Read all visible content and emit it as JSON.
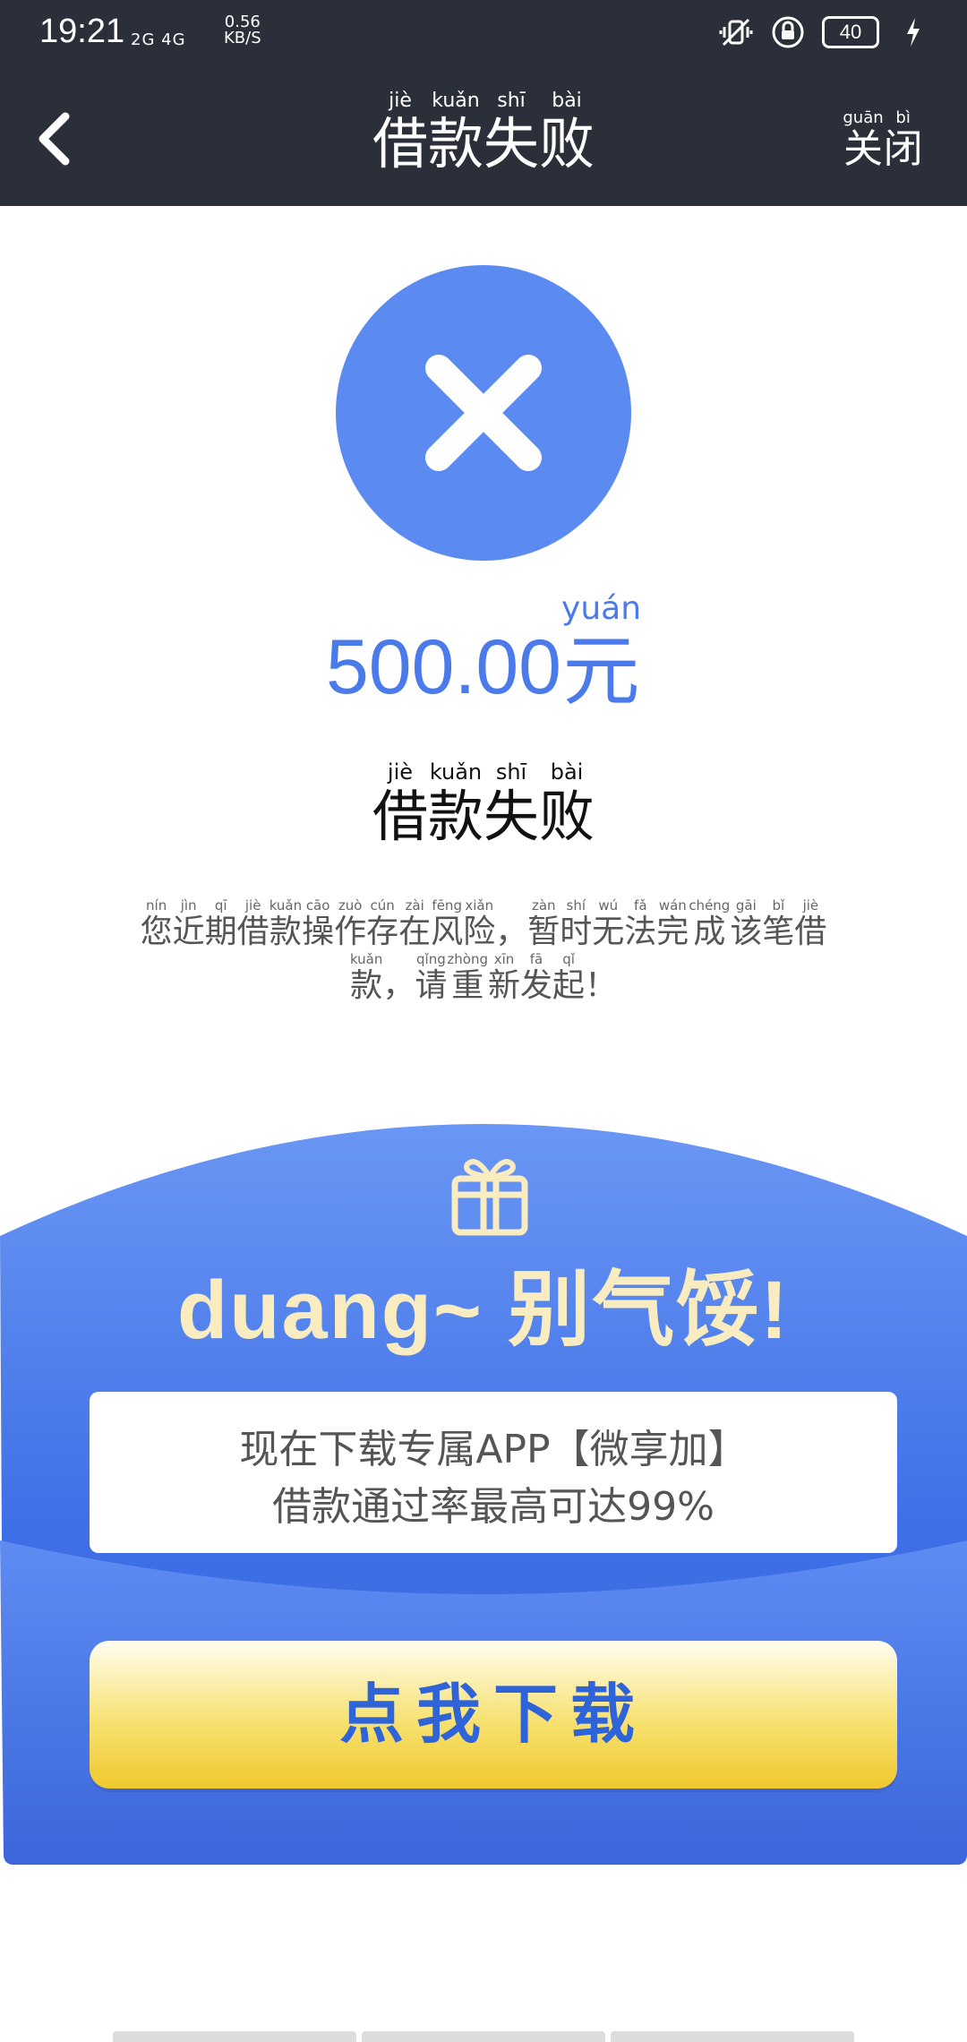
{
  "status_bar": {
    "time": "19:21",
    "network": "2G 4G",
    "speed": "0.56",
    "speed_unit": "KB/S",
    "battery": "40"
  },
  "nav": {
    "title": [
      {
        "py": "jiè",
        "hz": "借"
      },
      {
        "py": "kuǎn",
        "hz": "款"
      },
      {
        "py": "shī",
        "hz": "失"
      },
      {
        "py": "bài",
        "hz": "败"
      }
    ],
    "close": [
      {
        "py": "guān",
        "hz": "关"
      },
      {
        "py": "bì",
        "hz": "闭"
      }
    ]
  },
  "result": {
    "amount": "500.00",
    "unit": {
      "py": "yuán",
      "hz": "元"
    },
    "status": [
      {
        "py": "jiè",
        "hz": "借"
      },
      {
        "py": "kuǎn",
        "hz": "款"
      },
      {
        "py": "shī",
        "hz": "失"
      },
      {
        "py": "bài",
        "hz": "败"
      }
    ],
    "message_line1": [
      {
        "py": "nín",
        "hz": "您"
      },
      {
        "py": "jìn",
        "hz": "近"
      },
      {
        "py": "qī",
        "hz": "期"
      },
      {
        "py": "jiè",
        "hz": "借"
      },
      {
        "py": "kuǎn",
        "hz": "款"
      },
      {
        "py": "cāo",
        "hz": "操"
      },
      {
        "py": "zuò",
        "hz": "作"
      },
      {
        "py": "cún",
        "hz": "存"
      },
      {
        "py": "zài",
        "hz": "在"
      },
      {
        "py": "fēng",
        "hz": "风"
      },
      {
        "py": "xiǎn",
        "hz": "险"
      },
      {
        "py": "",
        "hz": "，"
      },
      {
        "py": "zàn",
        "hz": "暂"
      },
      {
        "py": "shí",
        "hz": "时"
      },
      {
        "py": "wú",
        "hz": "无"
      },
      {
        "py": "fǎ",
        "hz": "法"
      },
      {
        "py": "wán",
        "hz": "完"
      },
      {
        "py": "chéng",
        "hz": "成"
      },
      {
        "py": "gāi",
        "hz": "该"
      },
      {
        "py": "bǐ",
        "hz": "笔"
      },
      {
        "py": "jiè",
        "hz": "借"
      }
    ],
    "message_line2": [
      {
        "py": "kuǎn",
        "hz": "款"
      },
      {
        "py": "",
        "hz": "，"
      },
      {
        "py": "qǐng",
        "hz": "请"
      },
      {
        "py": "zhòng",
        "hz": "重"
      },
      {
        "py": "xīn",
        "hz": "新"
      },
      {
        "py": "fā",
        "hz": "发"
      },
      {
        "py": "qǐ",
        "hz": "起"
      },
      {
        "py": "",
        "hz": "！"
      }
    ]
  },
  "promo": {
    "title": "duang~ 别气馁!",
    "line1": "现在下载专属APP【微享加】",
    "line2": "借款通过率最高可达99%",
    "button": "点我下载",
    "colors": {
      "blue": "#4b7bea",
      "gold": "#f0c82e",
      "title": "#f8ecc0"
    }
  }
}
